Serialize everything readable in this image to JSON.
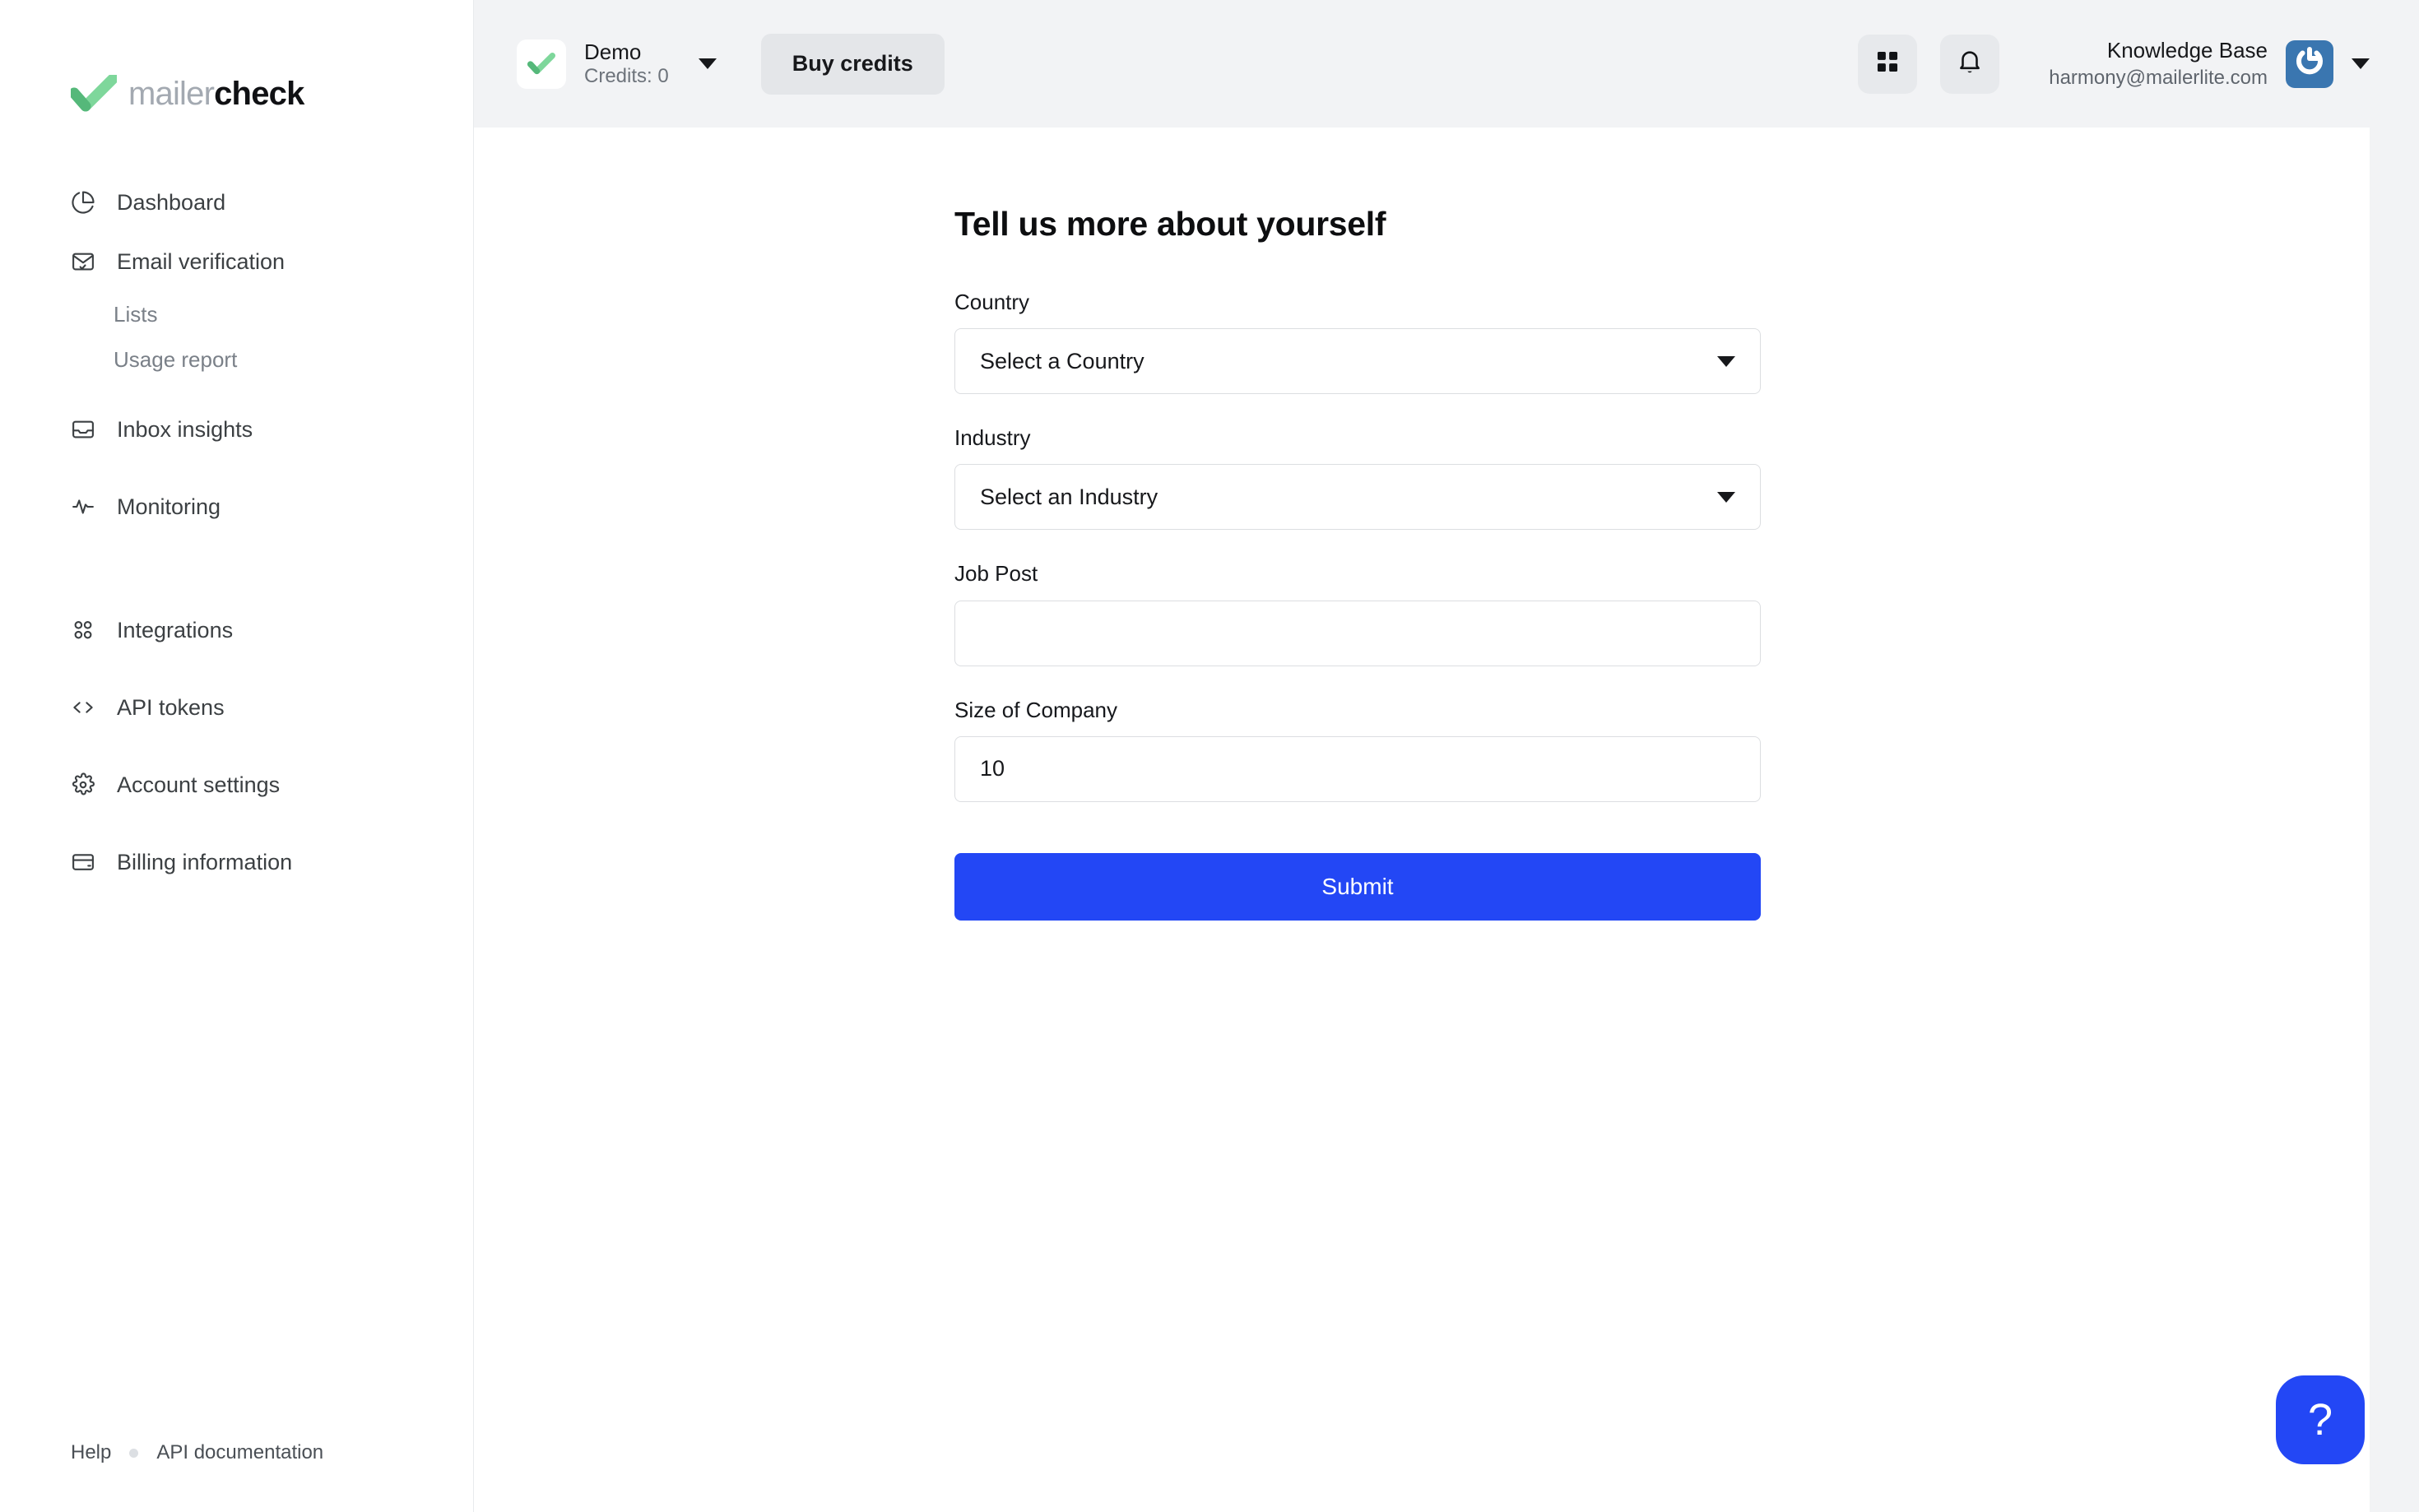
{
  "brand": {
    "logo_mailer": "mailer",
    "logo_check": "check",
    "accent_green": "#6ece8f",
    "accent_blue": "#2347f5"
  },
  "sidebar": {
    "items": [
      {
        "label": "Dashboard",
        "icon": "pie-chart-icon",
        "name": "dashboard"
      },
      {
        "label": "Email verification",
        "icon": "envelope-check-icon",
        "name": "email-verification"
      },
      {
        "label": "Inbox insights",
        "icon": "inbox-icon",
        "name": "inbox-insights"
      },
      {
        "label": "Monitoring",
        "icon": "activity-pulse-icon",
        "name": "monitoring"
      },
      {
        "label": "Integrations",
        "icon": "grid-apps-icon",
        "name": "integrations"
      },
      {
        "label": "API tokens",
        "icon": "code-brackets-icon",
        "name": "api-tokens"
      },
      {
        "label": "Account settings",
        "icon": "gear-icon",
        "name": "account-settings"
      },
      {
        "label": "Billing information",
        "icon": "credit-card-icon",
        "name": "billing-information"
      }
    ],
    "subitems": [
      {
        "label": "Lists",
        "name": "lists"
      },
      {
        "label": "Usage report",
        "name": "usage-report"
      }
    ],
    "footer": {
      "help": "Help",
      "api_documentation": "API documentation"
    }
  },
  "topbar": {
    "account_name": "Demo",
    "account_credits": "Credits: 0",
    "buy_credits_label": "Buy credits",
    "knowledge_base_label": "Knowledge Base",
    "user_email": "harmony@mailerlite.com"
  },
  "main": {
    "title": "Tell us more about yourself",
    "fields": [
      {
        "label": "Country",
        "type": "select",
        "value": "Select a Country",
        "name": "country"
      },
      {
        "label": "Industry",
        "type": "select",
        "value": "Select an Industry",
        "name": "industry"
      },
      {
        "label": "Job Post",
        "type": "text",
        "value": "",
        "placeholder": "",
        "name": "job-post"
      },
      {
        "label": "Size of Company",
        "type": "text",
        "value": "10",
        "placeholder": "",
        "name": "size-of-company"
      }
    ],
    "submit_label": "Submit",
    "help_label": "?"
  }
}
